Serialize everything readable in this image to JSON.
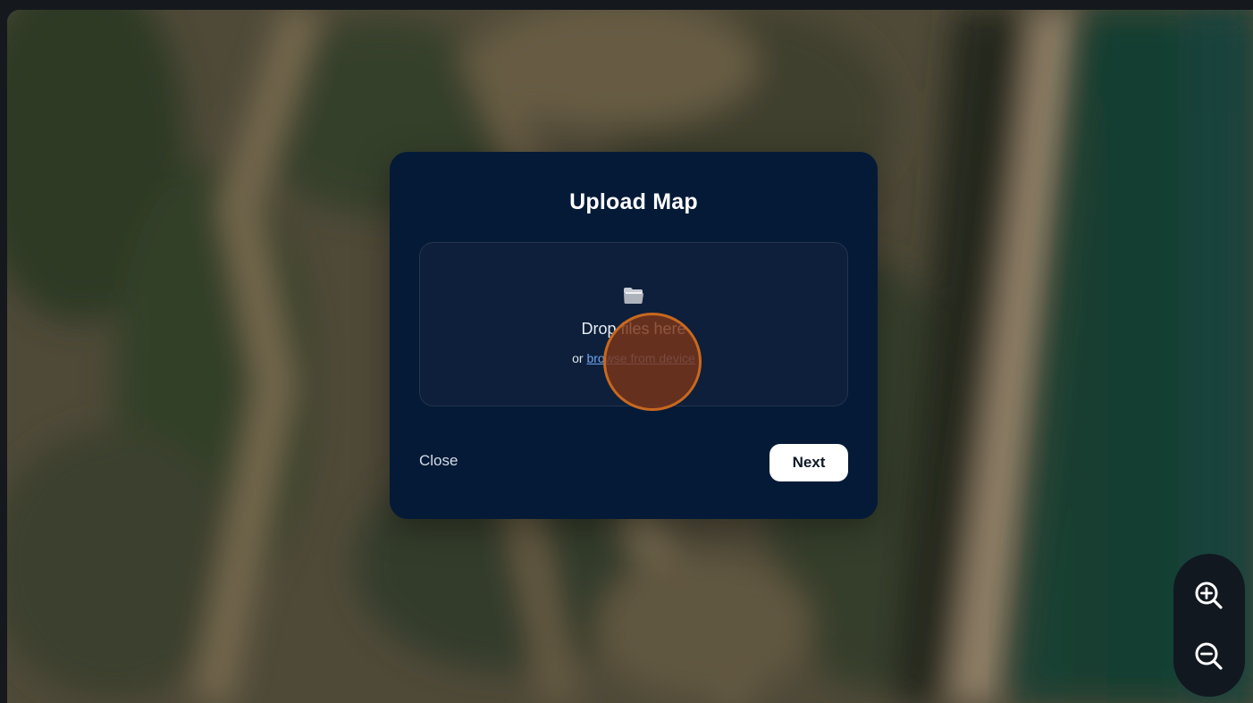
{
  "modal": {
    "title": "Upload Map",
    "dropzone": {
      "icon": "folder-icon",
      "primary_text": "Drop files here",
      "secondary_prefix": "or ",
      "browse_link": "browse from device"
    },
    "close_label": "Close",
    "next_label": "Next"
  },
  "map_controls": {
    "zoom_in_icon": "zoom-in-icon",
    "zoom_out_icon": "zoom-out-icon"
  },
  "colors": {
    "modal_bg": "#041a37",
    "link": "#6ea4f0",
    "click_indicator": "#ce6c20"
  }
}
